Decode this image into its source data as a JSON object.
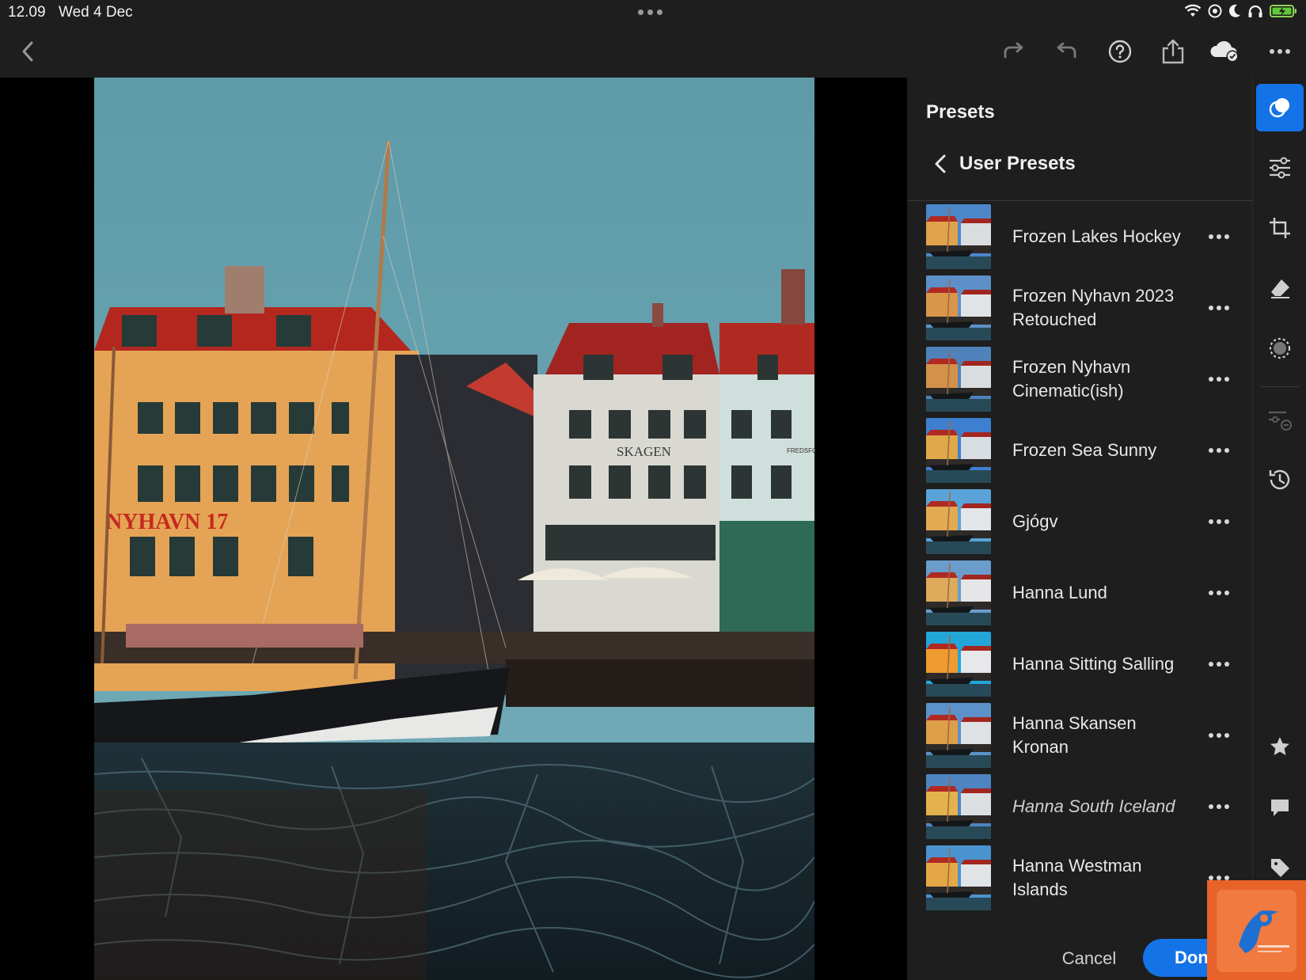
{
  "status_bar": {
    "time": "12.09",
    "date": "Wed 4 Dec",
    "icons": [
      "wifi-icon",
      "focus-icon",
      "moon-icon",
      "headphones-icon",
      "battery-charging-icon"
    ]
  },
  "toolbar": {
    "icons": [
      "back-chevron-icon",
      "redo-icon",
      "undo-icon",
      "help-icon",
      "share-icon",
      "cloud-synced-icon",
      "more-icon"
    ]
  },
  "presets_panel": {
    "title": "Presets",
    "group_title": "User Presets",
    "items": [
      {
        "label": "Frozen Lakes Hockey",
        "style": "normal"
      },
      {
        "label": "Frozen Nyhavn 2023 Retouched",
        "style": "normal"
      },
      {
        "label": "Frozen Nyhavn Cinematic(ish)",
        "style": "normal"
      },
      {
        "label": "Frozen Sea Sunny",
        "style": "normal"
      },
      {
        "label": "Gjógv",
        "style": "normal"
      },
      {
        "label": "Hanna Lund",
        "style": "normal"
      },
      {
        "label": "Hanna Sitting Salling",
        "style": "normal"
      },
      {
        "label": "Hanna Skansen Kronan",
        "style": "normal"
      },
      {
        "label": "Hanna South Iceland",
        "style": "italic"
      },
      {
        "label": "Hanna Westman Islands",
        "style": "normal"
      }
    ],
    "cancel_label": "Cancel",
    "done_label": "Done"
  },
  "right_rail": {
    "tools": [
      "presets-icon",
      "edit-sliders-icon",
      "crop-icon",
      "healing-eraser-icon",
      "masking-icon",
      "versions-icon",
      "history-icon",
      "rating-star-icon",
      "comment-icon",
      "tag-icon"
    ],
    "active_tool": "presets-icon"
  },
  "photo": {
    "signs": [
      "NYHAVN 17",
      "SKAGEN",
      "FREDSFO"
    ]
  },
  "colors": {
    "accent": "#1473e6",
    "panel_bg": "#1e1e1e",
    "sky": "#6aa3b0"
  }
}
